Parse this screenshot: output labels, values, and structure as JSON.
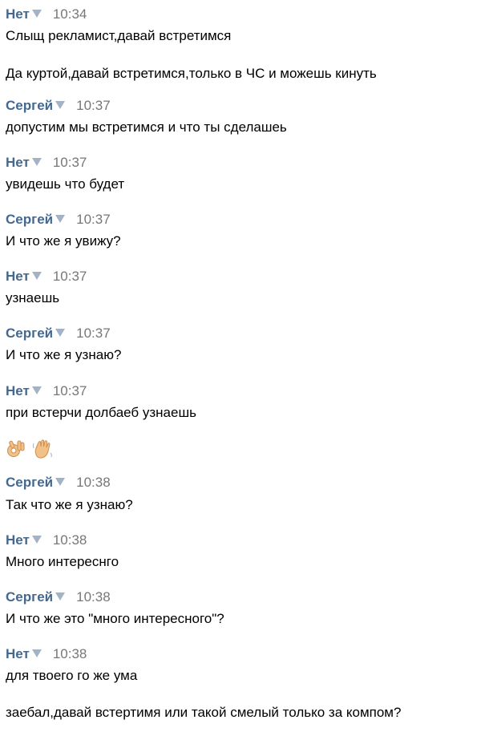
{
  "messages": [
    {
      "author": "Нет",
      "time": "10:34",
      "lines": [
        "Слыщ рекламист,давай встретимся",
        "Да куртой,давай встретимся,только в ЧС и можешь кинуть"
      ]
    },
    {
      "author": "Сергей",
      "time": "10:37",
      "lines": [
        "допустим мы встретимся и что ты сделашеь"
      ]
    },
    {
      "author": "Нет",
      "time": "10:37",
      "lines": [
        "увидешь что будет"
      ]
    },
    {
      "author": "Сергей",
      "time": "10:37",
      "lines": [
        "И что же я увижу?"
      ]
    },
    {
      "author": "Нет",
      "time": "10:37",
      "lines": [
        "узнаешь"
      ]
    },
    {
      "author": "Сергей",
      "time": "10:37",
      "lines": [
        "И что же я узнаю?"
      ]
    },
    {
      "author": "Нет",
      "time": "10:37",
      "lines": [
        "при встерчи долбаеб узнаешь"
      ],
      "emojis": [
        "ok-hand-emoji",
        "waving-hand-emoji"
      ]
    },
    {
      "author": "Сергей",
      "time": "10:38",
      "lines": [
        "Так что же я узнаю?"
      ]
    },
    {
      "author": "Нет",
      "time": "10:38",
      "lines": [
        "Много интереснго"
      ]
    },
    {
      "author": "Сергей",
      "time": "10:38",
      "lines": [
        "И что же это \"много интересного\"?"
      ]
    },
    {
      "author": "Нет",
      "time": "10:38",
      "lines": [
        "для твоего го же ума",
        "заебал,давай встертимя или такой смелый только за компом?"
      ]
    }
  ],
  "colors": {
    "author": "#45688e",
    "time": "#777777",
    "text": "#000000",
    "arrow": "#a3b2c4"
  },
  "icons": {
    "author_menu": "dropdown-arrow-icon"
  }
}
